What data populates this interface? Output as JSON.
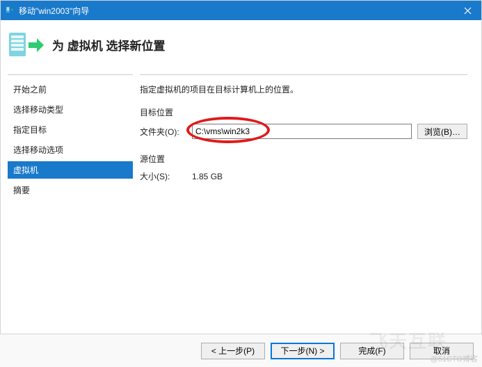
{
  "window": {
    "title": "移动\"win2003\"向导",
    "close_label": "×"
  },
  "header": {
    "title": "为 虚拟机 选择新位置"
  },
  "sidebar": {
    "items": [
      {
        "label": "开始之前"
      },
      {
        "label": "选择移动类型"
      },
      {
        "label": "指定目标"
      },
      {
        "label": "选择移动选项"
      },
      {
        "label": "虚拟机",
        "active": true
      },
      {
        "label": "摘要"
      }
    ]
  },
  "content": {
    "instruction": "指定虚拟机的项目在目标计算机上的位置。",
    "dest_section": "目标位置",
    "folder_label": "文件夹(O):",
    "folder_value": "C:\\vms\\win2k3",
    "browse_label": "浏览(B)…",
    "src_section": "源位置",
    "size_label": "大小(S):",
    "size_value": "1.85 GB"
  },
  "footer": {
    "prev": "< 上一步(P)",
    "next": "下一步(N) >",
    "finish": "完成(F)",
    "cancel": "取消"
  },
  "watermark": "@51CTO博客"
}
